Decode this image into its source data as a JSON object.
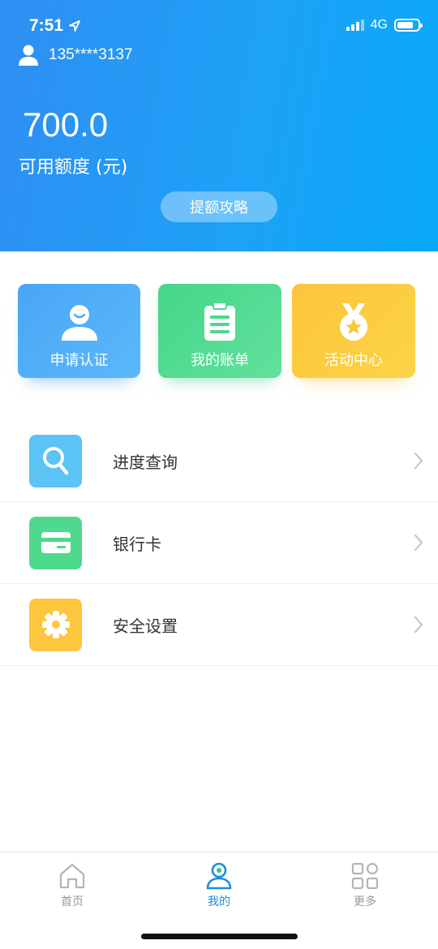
{
  "status": {
    "time": "7:51",
    "network": "4G"
  },
  "user": {
    "phone": "135****3137"
  },
  "credit": {
    "amount": "700.0",
    "label": "可用额度 (元)",
    "boost_button": "提额攻略"
  },
  "cards": [
    {
      "label": "申请认证",
      "icon": "user-icon",
      "color": "#4aa8f7"
    },
    {
      "label": "我的账单",
      "icon": "clipboard-icon",
      "color": "#4cd98f"
    },
    {
      "label": "活动中心",
      "icon": "medal-icon",
      "color": "#fcc73e"
    }
  ],
  "menu": [
    {
      "label": "进度查询",
      "icon": "search-icon",
      "color": "#5bc4f5"
    },
    {
      "label": "银行卡",
      "icon": "bank-card-icon",
      "color": "#4fd98d"
    },
    {
      "label": "安全设置",
      "icon": "gear-icon",
      "color": "#fcc73e"
    }
  ],
  "nav": [
    {
      "label": "首页",
      "icon": "home-icon"
    },
    {
      "label": "我的",
      "icon": "profile-icon",
      "active": true
    },
    {
      "label": "更多",
      "icon": "grid-icon"
    }
  ]
}
